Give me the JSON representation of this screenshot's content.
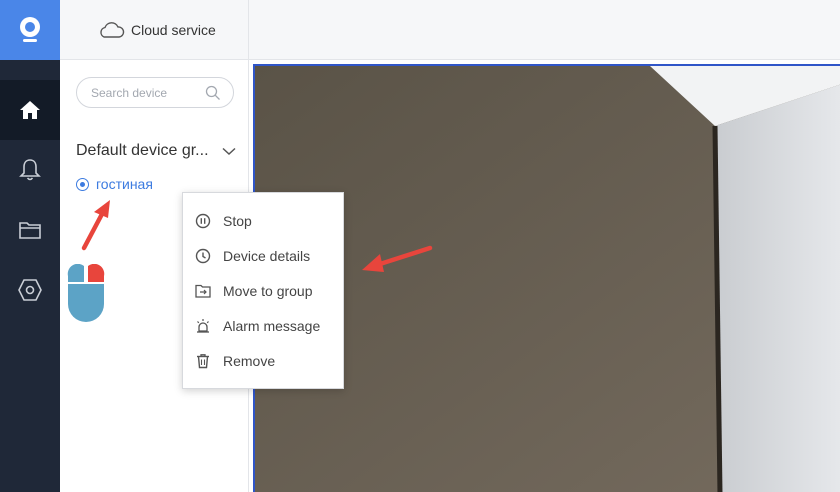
{
  "app": {
    "logo_icon": "camera-logo-icon",
    "accent_color": "#4a86e8"
  },
  "rail": {
    "items": [
      {
        "icon": "home-icon",
        "active": true
      },
      {
        "icon": "bell-icon",
        "active": false
      },
      {
        "icon": "folder-icon",
        "active": false
      },
      {
        "icon": "hexagon-settings-icon",
        "active": false
      }
    ]
  },
  "topbar": {
    "cloud_label": "Cloud service"
  },
  "sidebar": {
    "search_placeholder": "Search device",
    "group_label": "Default device gr...",
    "device_label": "гостиная"
  },
  "context_menu": {
    "items": [
      {
        "label": "Stop",
        "icon": "pause-icon"
      },
      {
        "label": "Device details",
        "icon": "info-clock-icon"
      },
      {
        "label": "Move to group",
        "icon": "folder-move-icon"
      },
      {
        "label": "Alarm message",
        "icon": "alarm-light-icon"
      },
      {
        "label": "Remove",
        "icon": "trash-icon"
      }
    ]
  },
  "annotations": {
    "arrow_color": "#e8453c",
    "mouse_icon": "mouse-right-click-icon"
  }
}
